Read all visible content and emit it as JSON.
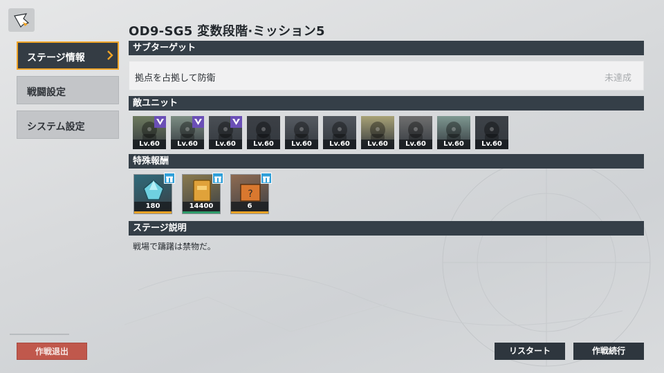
{
  "header": {
    "title": "OD9-SG5 変数段階·ミッション5"
  },
  "sidebar": {
    "items": [
      {
        "label": "ステージ情報",
        "active": true
      },
      {
        "label": "戦闘設定",
        "active": false
      },
      {
        "label": "システム設定",
        "active": false
      }
    ]
  },
  "sections": {
    "sub_target": "サブターゲット",
    "enemy_units": "敵ユニット",
    "special_rewards": "特殊報酬",
    "stage_description": "ステージ説明"
  },
  "objective": {
    "text": "拠点を占拠して防衛",
    "status": "未達成"
  },
  "enemies": [
    {
      "level": "Lv.60",
      "elite": true,
      "tint": "#6d7a5e"
    },
    {
      "level": "Lv.60",
      "elite": true,
      "tint": "#7d8e84"
    },
    {
      "level": "Lv.60",
      "elite": true,
      "tint": "#4a4f55"
    },
    {
      "level": "Lv.60",
      "elite": false,
      "tint": "#3c4046"
    },
    {
      "level": "Lv.60",
      "elite": false,
      "tint": "#565b62"
    },
    {
      "level": "Lv.60",
      "elite": false,
      "tint": "#51565d"
    },
    {
      "level": "Lv.60",
      "elite": false,
      "tint": "#a8a276"
    },
    {
      "level": "Lv.60",
      "elite": false,
      "tint": "#6f6f6f"
    },
    {
      "level": "Lv.60",
      "elite": false,
      "tint": "#7e9891"
    },
    {
      "level": "Lv.60",
      "elite": false,
      "tint": "#3d4248"
    }
  ],
  "rewards": [
    {
      "amount": "180",
      "item_icon": "crystal-icon",
      "bg": "#2f6a7a",
      "rarity": "#f0a427"
    },
    {
      "amount": "14400",
      "item_icon": "gold-bar-icon",
      "bg": "#8a7a4e",
      "rarity": "#2e9c6a"
    },
    {
      "amount": "6",
      "item_icon": "mystery-box-icon",
      "bg": "#8f6b52",
      "rarity": "#f0a427"
    }
  ],
  "description": "戦場で躊躇は禁物だ。",
  "buttons": {
    "retreat": "作戦退出",
    "restart": "リスタート",
    "continue": "作戦続行"
  },
  "colors": {
    "accent": "#f0a427",
    "section_bar": "#353f48",
    "retreat": "#c0584c",
    "gift_badge": "#2f9fd8",
    "elite_badge": "#6a4fb6"
  }
}
